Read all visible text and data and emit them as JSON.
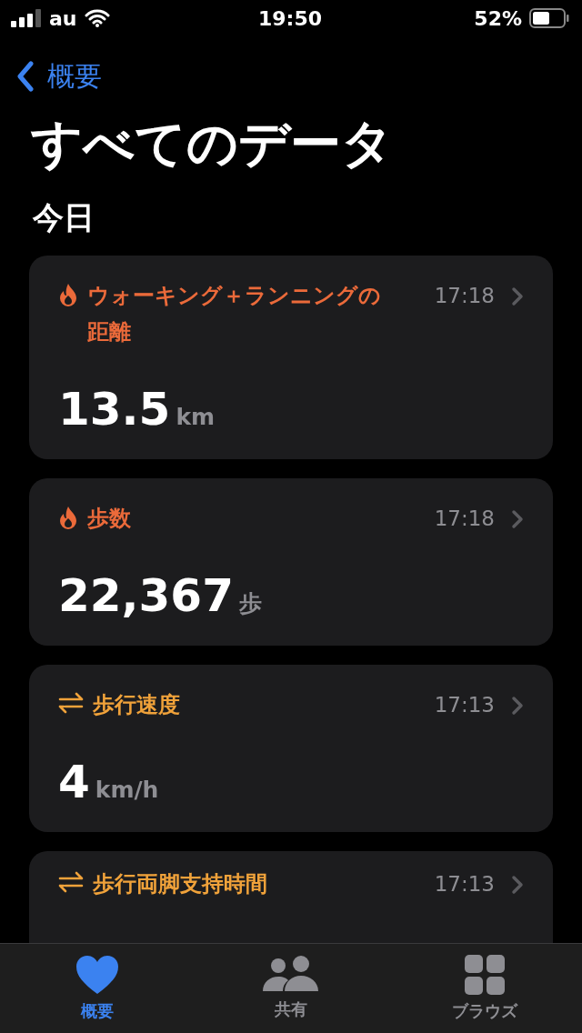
{
  "status_bar": {
    "carrier": "au",
    "time": "19:50",
    "battery": "52%"
  },
  "nav": {
    "back_label": "概要"
  },
  "title": "すべてのデータ",
  "section": "今日",
  "cards": [
    {
      "kind": "activity",
      "color": "#eb6a3a",
      "title": "ウォーキング＋ランニングの距離",
      "time": "17:18",
      "value": "13.5",
      "unit": "km"
    },
    {
      "kind": "activity",
      "color": "#eb6a3a",
      "title": "歩数",
      "time": "17:18",
      "value": "22,367",
      "unit": "歩"
    },
    {
      "kind": "mobility",
      "color": "#f0a23a",
      "title": "歩行速度",
      "time": "17:13",
      "value": "4",
      "unit": "km/h"
    },
    {
      "kind": "mobility",
      "color": "#f0a23a",
      "title": "歩行両脚支持時間",
      "time": "17:13"
    }
  ],
  "tab_bar": [
    {
      "kind": "heart",
      "label": "概要",
      "selected": true
    },
    {
      "kind": "people",
      "label": "共有",
      "selected": false
    },
    {
      "kind": "grid",
      "label": "ブラウズ",
      "selected": false
    }
  ]
}
